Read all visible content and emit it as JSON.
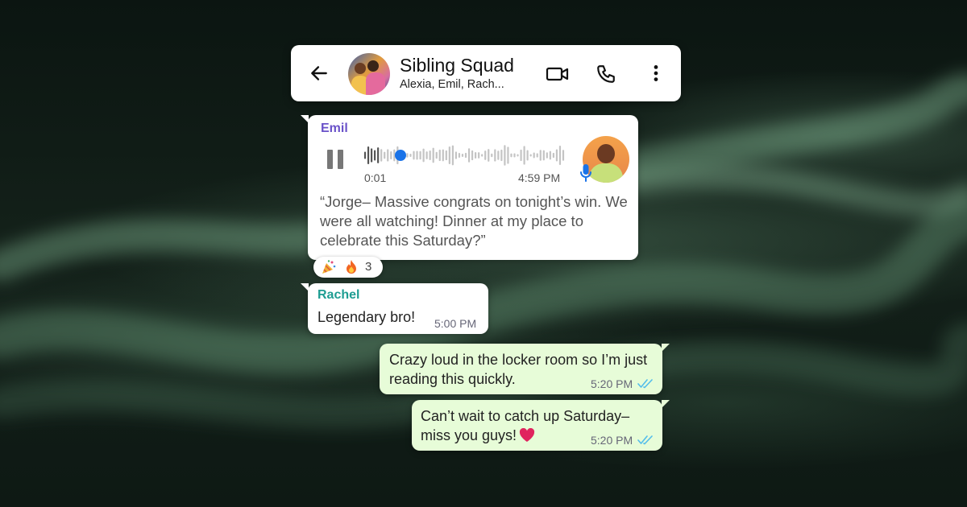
{
  "header": {
    "title": "Sibling Squad",
    "subtitle": "Alexia, Emil, Rach..."
  },
  "messages": {
    "voice_note": {
      "sender": "Emil",
      "elapsed": "0:01",
      "time": "4:59 PM",
      "progress": 0.08,
      "transcript": "“Jorge– Massive congrats on tonight’s win. We were all watching! Dinner at my place to celebrate this Saturday?”"
    },
    "reactions": {
      "emojis": [
        "party-popper",
        "fire"
      ],
      "count": "3"
    },
    "rachel": {
      "sender": "Rachel",
      "text": "Legendary bro!",
      "time": "5:00 PM"
    },
    "outgoing_1": {
      "text": "Crazy loud in the locker room so I’m just reading this quickly.",
      "time": "5:20 PM",
      "status": "read"
    },
    "outgoing_2": {
      "text": "Can’t wait to catch up Saturday– miss you guys!",
      "time": "5:20 PM",
      "status": "read",
      "emoji": "red-heart"
    }
  },
  "colors": {
    "sender_emil": "#6a52c9",
    "sender_rachel": "#1e9d92",
    "outgoing_bubble": "#e7fcd8",
    "read_ticks": "#53bdeb",
    "voice_progress": "#1a73e8"
  }
}
